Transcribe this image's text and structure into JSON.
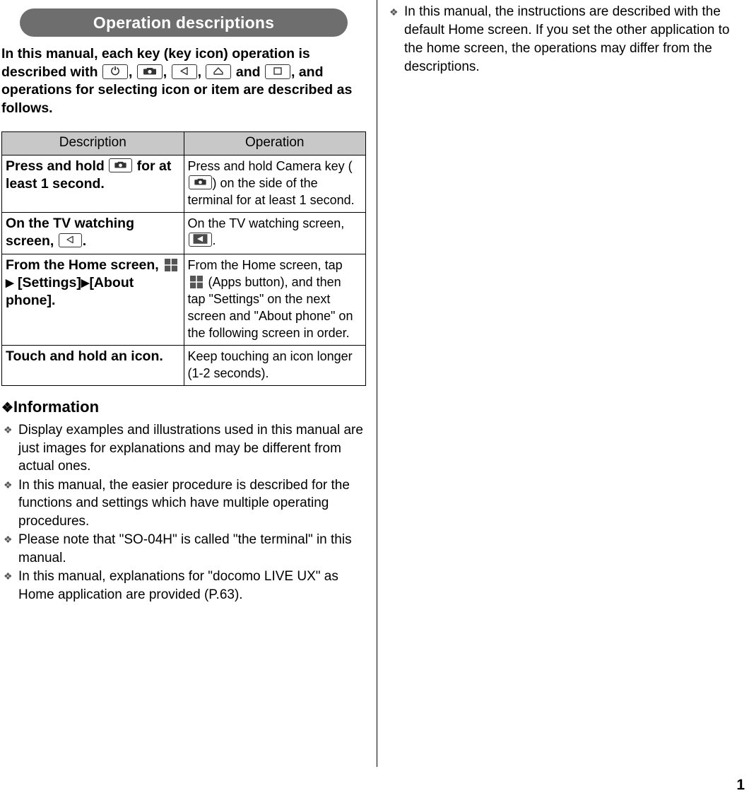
{
  "section": {
    "title": "Operation descriptions"
  },
  "intro": {
    "part1": "In this manual, each key (key icon) operation is described with",
    "sep": ",",
    "and": "and",
    "part2": ", and operations for selecting icon or item are described as follows."
  },
  "icons": {
    "power": "power-key-icon",
    "camera": "camera-key-icon",
    "back": "back-key-icon",
    "home": "home-key-icon",
    "recents": "recent-apps-key-icon",
    "apps": "apps-button-icon"
  },
  "table": {
    "headers": [
      "Description",
      "Operation"
    ],
    "rows": [
      {
        "desc_pre": "Press and hold",
        "desc_post": "for at least 1 second.",
        "oper_pre": "Press and hold Camera key (",
        "oper_post": ") on the side of the terminal for at least 1 second."
      },
      {
        "desc_pre": "On the TV watching screen,",
        "desc_post": ".",
        "oper_pre": "On the TV watching screen,",
        "oper_post": "."
      },
      {
        "desc_pre": "From the Home screen,",
        "desc_post": "[Settings]",
        "desc_post2": "[About phone].",
        "oper_pre": "From the Home screen, tap",
        "oper_post": "(Apps button), and then tap \"Settings\" on the next screen and \"About phone\" on the following screen in order."
      },
      {
        "desc_pre": "Touch and hold an icon.",
        "oper_pre": "Keep touching an icon longer (1-2 seconds)."
      }
    ]
  },
  "information": {
    "heading": "Information",
    "items": [
      "Display examples and illustrations used in this manual are just images for explanations and may be different from actual ones.",
      "In this manual, the easier procedure is described for the functions and settings which have multiple operating procedures.",
      "Please note that \"SO-04H\" is called \"the terminal\" in this manual.",
      "In this manual, explanations for \"docomo LIVE UX\" as Home application are provided (P.63)."
    ]
  },
  "right_column": {
    "items": [
      "In this manual, the instructions are described with the default Home screen. If you set the other application to the home screen, the operations may differ from the descriptions."
    ]
  },
  "page_number": "1"
}
